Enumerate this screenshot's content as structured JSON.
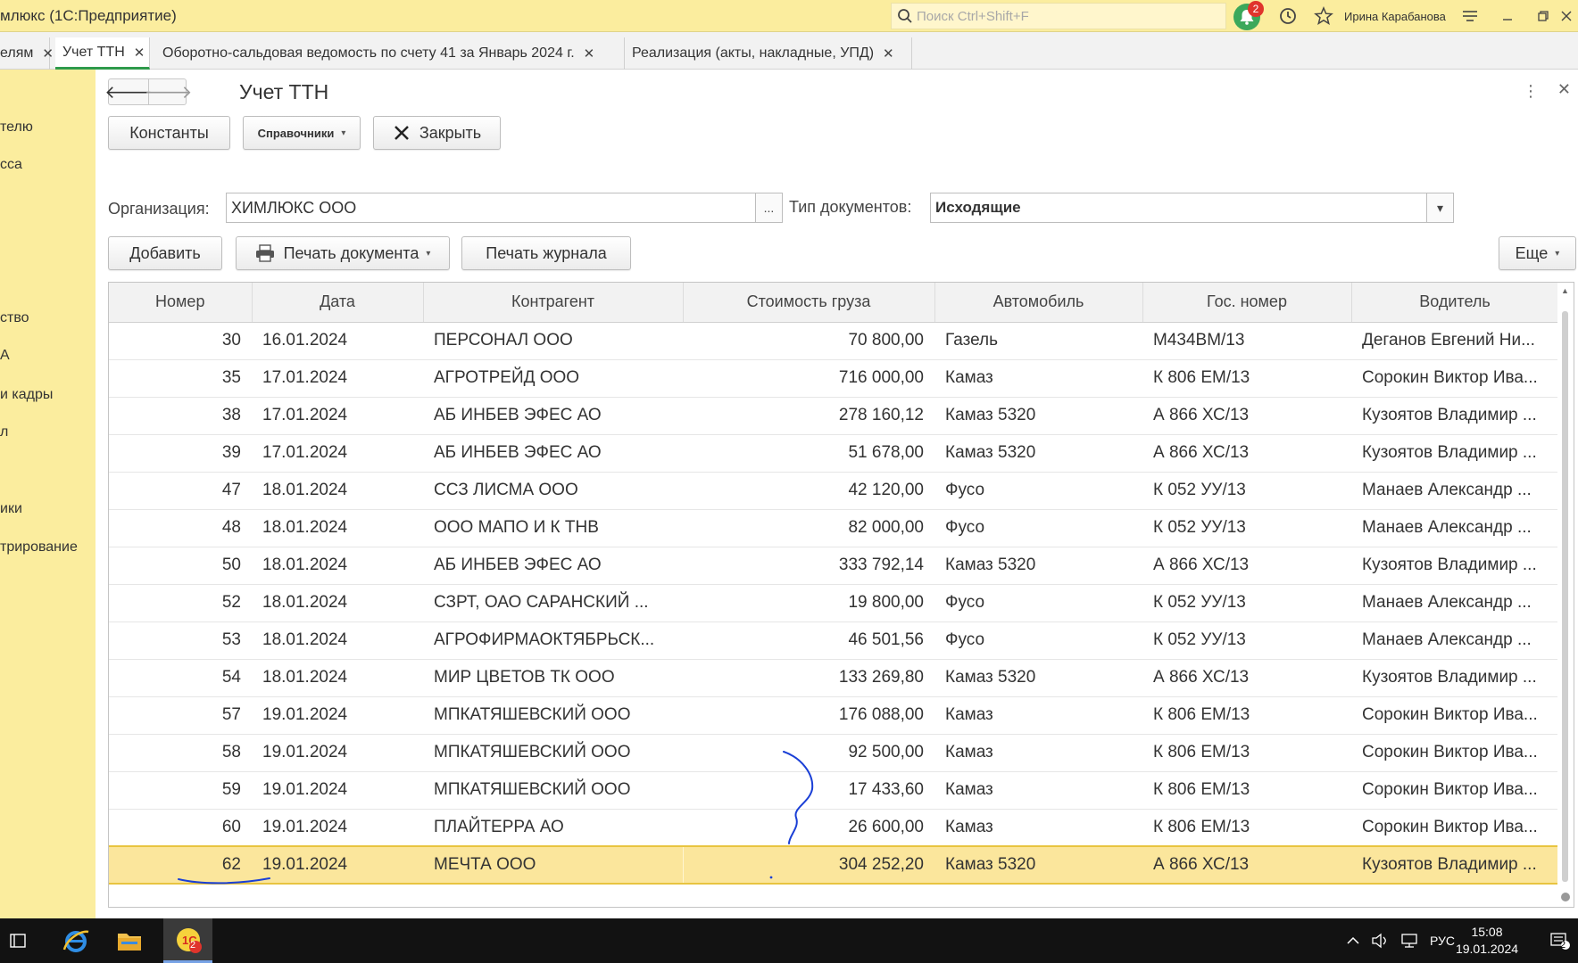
{
  "titlebar": {
    "app_title": "млюкс  (1С:Предприятие)",
    "search_placeholder": "Поиск Ctrl+Shift+F",
    "notification_count": "2",
    "user": "Ирина Карабанова"
  },
  "tabs": [
    {
      "label": "елям",
      "active": false
    },
    {
      "label": "Учет ТТН",
      "active": true
    },
    {
      "label": "Оборотно-сальдовая ведомость по счету 41 за Январь 2024 г.",
      "active": false
    },
    {
      "label": "Реализация (акты, накладные, УПД)",
      "active": false
    }
  ],
  "sidebar": {
    "items": [
      "телю",
      "сса",
      "ство",
      "А",
      " и кадры",
      "л",
      "ики",
      "трирование"
    ]
  },
  "main": {
    "title": "Учет ТТН",
    "buttons": {
      "constants": "Константы",
      "directories": "Справочники",
      "close": "Закрыть",
      "add": "Добавить",
      "print_document": "Печать документа",
      "print_journal": "Печать журнала",
      "more": "Еще"
    },
    "organization_label": "Организация:",
    "organization_value": "ХИМЛЮКС ООО",
    "doc_type_label": "Тип документов:",
    "doc_type_value": "Исходящие"
  },
  "table": {
    "columns": [
      "Номер",
      "Дата",
      "Контрагент",
      "Стоимость груза",
      "Автомобиль",
      "Гос. номер",
      "Водитель"
    ],
    "rows": [
      [
        "30",
        "16.01.2024",
        "ПЕРСОНАЛ ООО",
        "70 800,00",
        "Газель",
        "М434ВМ/13",
        "Деганов Евгений Ни..."
      ],
      [
        "35",
        "17.01.2024",
        "АГРОТРЕЙД ООО",
        "716 000,00",
        "Камаз",
        "К 806 ЕМ/13",
        "Сорокин Виктор Ива..."
      ],
      [
        "38",
        "17.01.2024",
        "АБ ИНБЕВ ЭФЕС АО",
        "278 160,12",
        "Камаз 5320",
        "А 866 ХС/13",
        "Кузоятов Владимир ..."
      ],
      [
        "39",
        "17.01.2024",
        "АБ ИНБЕВ ЭФЕС АО",
        "51 678,00",
        "Камаз 5320",
        "А 866 ХС/13",
        "Кузоятов Владимир ..."
      ],
      [
        "47",
        "18.01.2024",
        "ССЗ ЛИСМА ООО",
        "42 120,00",
        "Фусо",
        "К 052 УУ/13",
        "Манаев Александр ..."
      ],
      [
        "48",
        "18.01.2024",
        "ООО МАПО И К ТНВ",
        "82 000,00",
        "Фусо",
        "К 052 УУ/13",
        "Манаев Александр ..."
      ],
      [
        "50",
        "18.01.2024",
        "АБ ИНБЕВ ЭФЕС АО",
        "333 792,14",
        "Камаз 5320",
        "А 866 ХС/13",
        "Кузоятов Владимир ..."
      ],
      [
        "52",
        "18.01.2024",
        "СЗРТ, ОАО САРАНСКИЙ ...",
        "19 800,00",
        "Фусо",
        "К 052 УУ/13",
        "Манаев Александр ..."
      ],
      [
        "53",
        "18.01.2024",
        "АГРОФИРМАОКТЯБРЬСК...",
        "46 501,56",
        "Фусо",
        "К 052 УУ/13",
        "Манаев Александр ..."
      ],
      [
        "54",
        "18.01.2024",
        "МИР ЦВЕТОВ ТК ООО",
        "133 269,80",
        "Камаз 5320",
        "А 866 ХС/13",
        "Кузоятов Владимир ..."
      ],
      [
        "57",
        "19.01.2024",
        "МПКАТЯШЕВСКИЙ ООО",
        "176 088,00",
        "Камаз",
        "К 806 ЕМ/13",
        "Сорокин Виктор Ива..."
      ],
      [
        "58",
        "19.01.2024",
        "МПКАТЯШЕВСКИЙ ООО",
        "92 500,00",
        "Камаз",
        "К 806 ЕМ/13",
        "Сорокин Виктор Ива..."
      ],
      [
        "59",
        "19.01.2024",
        "МПКАТЯШЕВСКИЙ ООО",
        "17 433,60",
        "Камаз",
        "К 806 ЕМ/13",
        "Сорокин Виктор Ива..."
      ],
      [
        "60",
        "19.01.2024",
        "ПЛАЙТЕРРА АО",
        "26 600,00",
        "Камаз",
        "К 806 ЕМ/13",
        "Сорокин Виктор Ива..."
      ],
      [
        "62",
        "19.01.2024",
        "МЕЧТА ООО",
        "304 252,20",
        "Камаз 5320",
        "А 866 ХС/13",
        "Кузоятов Владимир ..."
      ]
    ],
    "selected_row": 14
  },
  "taskbar": {
    "language": "РУС",
    "time": "15:08",
    "date": "19.01.2024",
    "app_badge": "2",
    "notification_badge": "2"
  },
  "colors": {
    "titlebar_bg": "#fbed9e",
    "selected_row_bg": "#fbe69c",
    "active_tab_underline": "#2e9a4b",
    "taskbar_bg": "#121212",
    "ink": "#1a3fd6"
  },
  "icons": [
    "search-icon",
    "bell-icon",
    "history-icon",
    "star-icon",
    "menu-icon",
    "minimize-icon",
    "restore-icon",
    "close-icon",
    "back-arrow-icon",
    "forward-arrow-icon",
    "kebab-icon",
    "printer-icon",
    "windows-start-icon",
    "ie-icon",
    "folder-icon",
    "1c-icon"
  ]
}
